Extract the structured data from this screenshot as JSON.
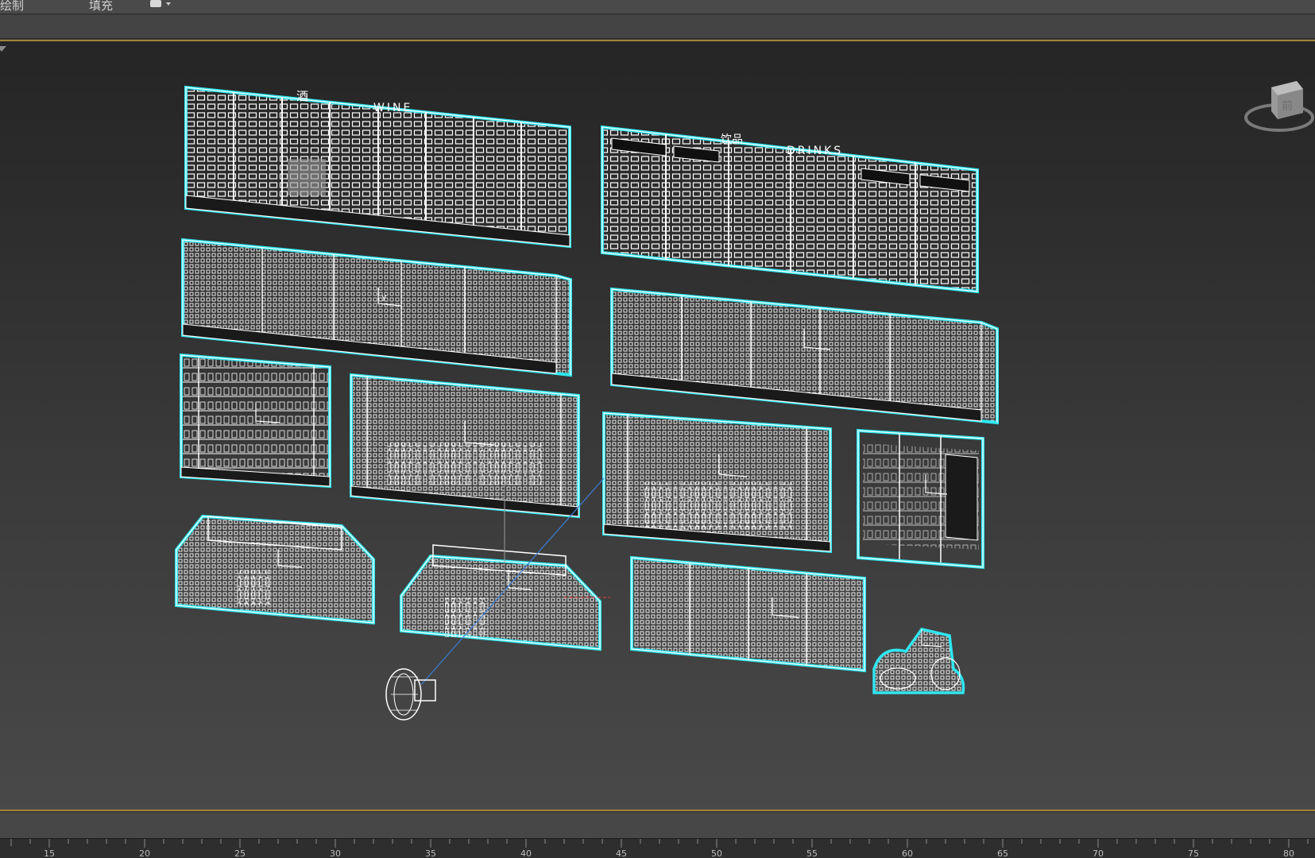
{
  "ribbon": {
    "tab_draw": "绘制",
    "tab_fill": "填充"
  },
  "viewcube": {
    "face_label": "前"
  },
  "scene": {
    "top_left_sign": "酒",
    "top_left_banner": "WINE",
    "top_right_sign": "饮品",
    "top_right_banner": "DRINKS",
    "axis_label": "y"
  },
  "timeline": {
    "ticks": [
      "15",
      "20",
      "25",
      "30",
      "35",
      "40",
      "45",
      "50",
      "55",
      "60",
      "65",
      "70",
      "75",
      "80"
    ]
  },
  "colors": {
    "selection_outline": "#2ee6f0",
    "wireframe": "#ffffff",
    "viewport_frame": "#a0843a",
    "camera_line": "#3a7fd6",
    "target_line": "#d23a3a"
  }
}
